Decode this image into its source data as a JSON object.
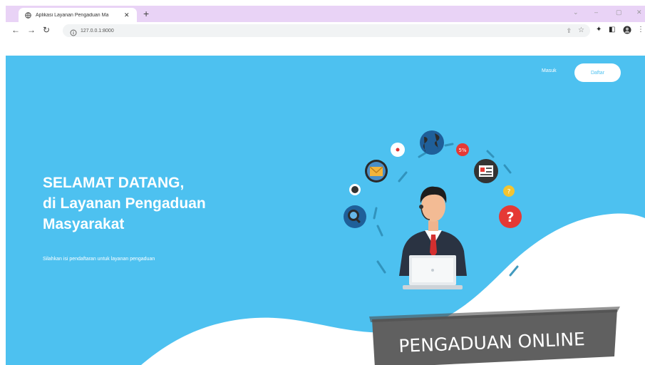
{
  "browser": {
    "tab_title": "Aplikasi Layanan Pengaduan Ma",
    "tab_close": "✕",
    "new_tab": "+",
    "url": "127.0.0.1:8000",
    "win_ctrls": [
      "⌄",
      "–",
      "▢",
      "✕"
    ]
  },
  "nav": {
    "login": "Masuk",
    "register": "Daftar"
  },
  "hero": {
    "headline": [
      "SELAMAT DATANG,",
      "di Layanan Pengaduan",
      "Masyarakat"
    ],
    "subtitle": "Silahkan isi pendaftaran untuk layanan pengaduan"
  },
  "illustration": {
    "banner": "PENGADUAN ONLINE",
    "icons": [
      "globe-icon",
      "mail-icon",
      "help-icon",
      "search-icon",
      "chat-icon",
      "id-card-icon",
      "sale-badge-icon",
      "lightbulb-icon",
      "agent-figure",
      "laptop-icon"
    ]
  },
  "colors": {
    "hero_bg": "#4dc1f0",
    "tabstrip": "#e9d3f6",
    "banner": "#6b6b6b",
    "help_red": "#e53935"
  }
}
